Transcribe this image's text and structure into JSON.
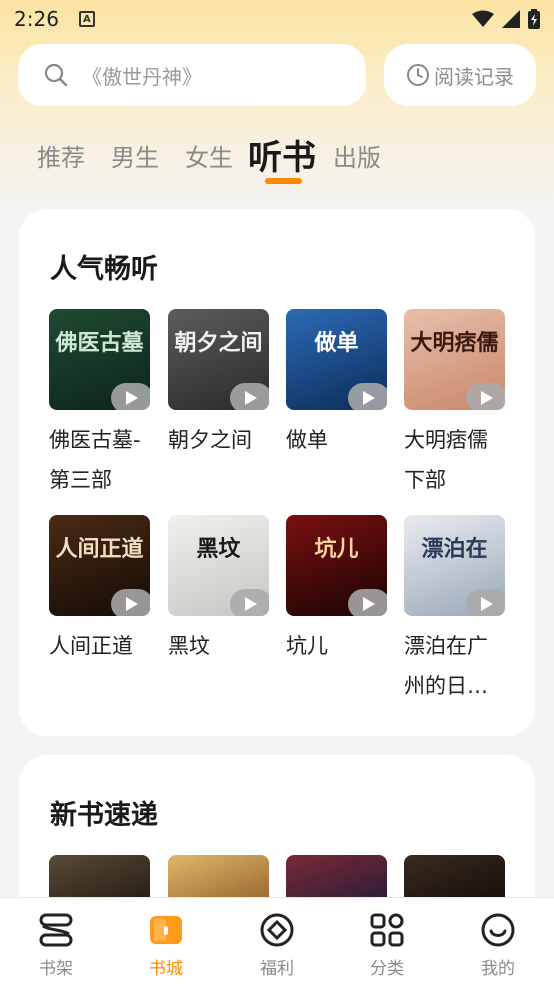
{
  "status_bar": {
    "time": "2:26",
    "notification_icon": "a-icon"
  },
  "search": {
    "placeholder": "《傲世丹神》"
  },
  "header": {
    "history_label": "阅读记录"
  },
  "tabs": [
    {
      "label": "推荐"
    },
    {
      "label": "男生"
    },
    {
      "label": "女生"
    },
    {
      "label": "听书",
      "active": true
    },
    {
      "label": "出版"
    }
  ],
  "popular": {
    "title": "人气畅听",
    "books": [
      {
        "title": "佛医古墓-第三部",
        "cover_text": "佛医古墓",
        "cover_colors": [
          "#1f4a33",
          "#0c2418"
        ],
        "text_color": "#cfe8d6"
      },
      {
        "title": "朝夕之间",
        "cover_text": "朝夕之间",
        "cover_colors": [
          "#5c5c5c",
          "#2a2a2a"
        ],
        "text_color": "#f2f2f2"
      },
      {
        "title": "做单",
        "cover_text": "做单",
        "cover_colors": [
          "#2b6bb5",
          "#0d2c58"
        ],
        "text_color": "#ffffff"
      },
      {
        "title": "大明痞儒下部",
        "cover_text": "大明痞儒",
        "cover_colors": [
          "#e7c0aa",
          "#c9866b"
        ],
        "text_color": "#3a1a10"
      },
      {
        "title": "人间正道",
        "cover_text": "人间正道",
        "cover_colors": [
          "#4a2a16",
          "#150b05"
        ],
        "text_color": "#f4dcc0"
      },
      {
        "title": "黑坟",
        "cover_text": "黑坟",
        "cover_colors": [
          "#f2f0ec",
          "#c8c6c2"
        ],
        "text_color": "#1a1a1a"
      },
      {
        "title": "坑儿",
        "cover_text": "坑儿",
        "cover_colors": [
          "#7a0f0f",
          "#1a0404"
        ],
        "text_color": "#ffd2a0"
      },
      {
        "title": "漂泊在广州的日…",
        "cover_text": "漂泊在",
        "cover_colors": [
          "#e9ecf1",
          "#9aa7b8"
        ],
        "text_color": "#2a3a5a"
      }
    ]
  },
  "new_books": {
    "title": "新书速递",
    "covers": [
      {
        "cover_colors": [
          "#5a4a38",
          "#1e160e"
        ]
      },
      {
        "cover_colors": [
          "#e0b86a",
          "#8a5a26"
        ]
      },
      {
        "cover_colors": [
          "#7a2a34",
          "#1e1a3a"
        ]
      },
      {
        "cover_colors": [
          "#3a2a1e",
          "#0f0b08"
        ]
      }
    ]
  },
  "bottom_nav": [
    {
      "label": "书架",
      "icon": "bookshelf-icon"
    },
    {
      "label": "书城",
      "icon": "bookstore-icon",
      "active": true
    },
    {
      "label": "福利",
      "icon": "welfare-icon"
    },
    {
      "label": "分类",
      "icon": "category-icon"
    },
    {
      "label": "我的",
      "icon": "profile-icon"
    }
  ],
  "colors": {
    "accent": "#ff8a00",
    "muted": "#8a8a8a"
  }
}
